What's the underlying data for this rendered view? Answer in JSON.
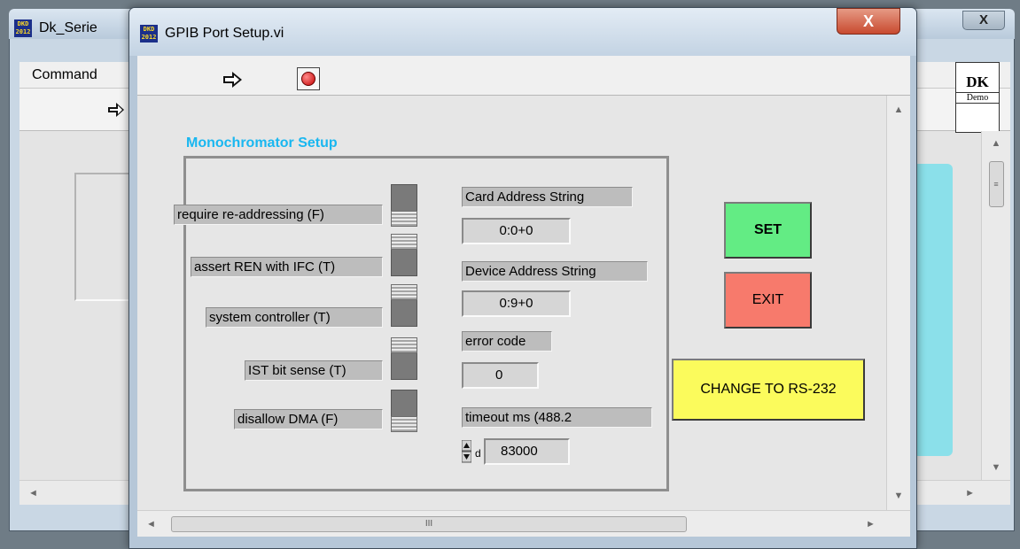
{
  "background_window": {
    "title": "Dk_Serie",
    "menu_label": "Command",
    "close_label": "X",
    "dk_logo": {
      "line1": "DK",
      "line2": "Demo"
    }
  },
  "window": {
    "title": "GPIB Port Setup.vi",
    "close_label": "X",
    "app_icon_text": "DKD 2012"
  },
  "toolbar": {
    "run_icon": "run-arrow-icon",
    "abort_icon": "stop-icon"
  },
  "section": {
    "title": "Monochromator Setup"
  },
  "switches": [
    {
      "label": "require re-addressing (F)",
      "state": false
    },
    {
      "label": "assert REN with IFC (T)",
      "state": true
    },
    {
      "label": "system controller (T)",
      "state": true
    },
    {
      "label": "IST bit sense (T)",
      "state": true
    },
    {
      "label": "disallow DMA (F)",
      "state": false
    }
  ],
  "fields": {
    "card_address": {
      "label": "Card Address String",
      "value": "0:0+0"
    },
    "device_address": {
      "label": "Device Address String",
      "value": "0:9+0"
    },
    "error_code": {
      "label": "error code",
      "value": "0"
    },
    "timeout": {
      "label": "timeout ms (488.2",
      "value": "83000",
      "radix": "d"
    }
  },
  "buttons": {
    "set": "SET",
    "exit": "EXIT",
    "change": "CHANGE TO RS-232"
  },
  "colors": {
    "section_title": "#19b7f0",
    "set": "#63ec84",
    "exit": "#f77a6c",
    "change": "#fbfb5c"
  },
  "scroll_glyphs": {
    "up": "▲",
    "down": "▼",
    "left": "◄",
    "right": "►",
    "grip": "III"
  }
}
